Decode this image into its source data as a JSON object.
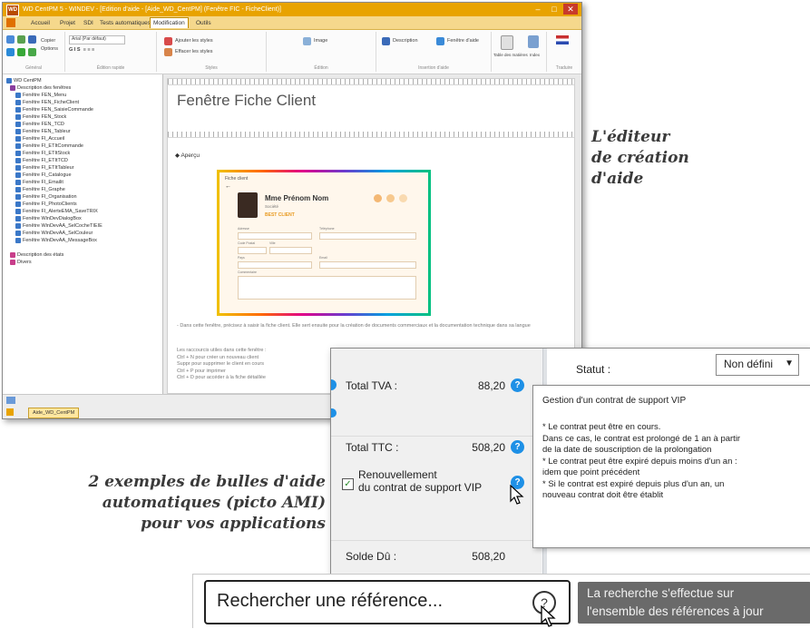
{
  "editor": {
    "window_title": "WD CentPM 5 - WINDEV - [Edition d'aide - [Aide_WD_CentPM] (Fenêtre FIC - FicheClient)]",
    "menu_tabs": [
      "Accueil",
      "Projet",
      "SDI",
      "Tests automatiques",
      "Modification",
      "Outils"
    ],
    "active_tab": "Modification",
    "ribbon": {
      "copy": "Copier",
      "options": "Options",
      "font": "Arial (Par défaut)",
      "insert_styles": "Ajouter les styles",
      "remove_styles": "Effacer les styles",
      "image": "Image",
      "description": "Description",
      "window_frame": "Fenêtre d'aide",
      "toc": "Table des matières",
      "index": "Index",
      "group_labels": [
        "Général",
        "Édition rapide",
        "Styles",
        "Édition",
        "Insertion d'aide",
        "Traduire"
      ]
    },
    "tree": {
      "root": "WD CentPM",
      "groups": [
        "Description des fenêtres",
        "Description des états",
        "Divers"
      ],
      "items": [
        "Fenêtre FEN_Menu",
        "Fenêtre FEN_FicheClient",
        "Fenêtre FEN_SaisieCommande",
        "Fenêtre FEN_Stock",
        "Fenêtre FEN_TCD",
        "Fenêtre FEN_Tableur",
        "Fenêtre FI_Accueil",
        "Fenêtre FI_ETItCommande",
        "Fenêtre FI_ETItStock",
        "Fenêtre FI_ETItTCD",
        "Fenêtre FI_ETItTableur",
        "Fenêtre FI_Catalogue",
        "Fenêtre FI_Emailit",
        "Fenêtre FI_Graphe",
        "Fenêtre FI_Organisation",
        "Fenêtre FI_PhotoClients",
        "Fenêtre FI_AlerteEMA_SaveTRIX",
        "Fenêtre WinDevDialogBox",
        "Fenêtre WinDevAA_SelCocheTIEIE",
        "Fenêtre WinDevAA_SelCouleur",
        "Fenêtre WinDevAA_MessageBox"
      ]
    },
    "doc": {
      "title": "Fenêtre Fiche Client",
      "apercu": "◆ Aperçu",
      "preview": {
        "header": "Fiche client",
        "name": "Mme Prénom Nom",
        "subtitle": "Société",
        "badge": "BEST CLIENT",
        "labels": [
          "Adresse",
          "Code Postal",
          "Ville",
          "Pays",
          "Commentaire",
          "Téléphone",
          "Email"
        ]
      },
      "paragraph1": "- Dans cette fenêtre, précisez à saisir la fiche client. Elle sert ensuite pour la création de documents commerciaux et la documentation technique dans sa langue",
      "shortcuts": [
        "Les raccourcis utiles dans cette fenêtre :",
        "Ctrl + N pour créer un nouveau client",
        "Suppr pour supprimer le client en cours",
        "Ctrl + P pour imprimer",
        "Ctrl + D pour accéder à la fiche détaillée"
      ]
    },
    "status_tab": "Aide_WD_CentPM"
  },
  "captions": {
    "editor_caption": [
      "L'éditeur",
      "de création",
      "d'aide"
    ],
    "bubbles_caption": [
      "2 exemples de bulles d'aide",
      "automatiques (picto AMI)",
      "pour vos applications"
    ]
  },
  "vip": {
    "total_tva_label": "Total TVA :",
    "total_tva_value": "88,20",
    "total_ttc_label": "Total TTC :",
    "total_ttc_value": "508,20",
    "renewal_label_1": "Renouvellement",
    "renewal_label_2": "du contrat de support VIP",
    "solde_label": "Solde Dû :",
    "solde_value": "508,20",
    "statut_label": "Statut :",
    "statut_value": "Non défini",
    "tooltip_title": "Gestion d'un contrat de support VIP",
    "tooltip_lines": [
      "* Le contrat peut être en cours.",
      "Dans ce cas, le contrat est prolongé de 1 an à partir",
      "de la date de souscription de la prolongation",
      "* Le contrat peut être expiré depuis moins d'un an :",
      "idem que point précédent",
      "* Si le contrat est expiré depuis plus d'un an, un",
      "nouveau contrat doit être établit"
    ]
  },
  "search": {
    "placeholder": "Rechercher une référence...",
    "help_glyph": "?",
    "tooltip_line1": "La recherche s'effectue sur",
    "tooltip_line2": "l'ensemble des références à jour"
  }
}
